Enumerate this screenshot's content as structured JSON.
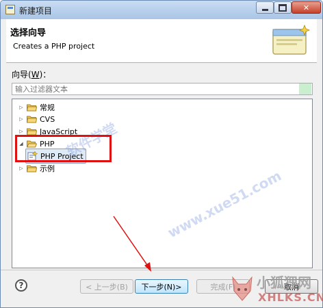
{
  "window": {
    "title": "新建项目"
  },
  "header": {
    "title": "选择向导",
    "description": "Creates a PHP project"
  },
  "wizards": {
    "label_prefix": "向导(",
    "label_mnemonic": "W",
    "label_suffix": ")：",
    "filter_placeholder": "输入过滤器文本"
  },
  "tree": {
    "items": [
      {
        "label": "常规",
        "state": "collapsed"
      },
      {
        "label": "CVS",
        "state": "collapsed"
      },
      {
        "label": "JavaScript",
        "state": "collapsed"
      },
      {
        "label": "PHP",
        "state": "expanded"
      },
      {
        "label": "PHP Project",
        "state": "selected"
      },
      {
        "label": "示例",
        "state": "collapsed"
      }
    ]
  },
  "buttons": {
    "back": "< 上一步(B)",
    "next": "下一步(N)>",
    "finish": "完成(F)",
    "cancel": "取消",
    "help": "?"
  },
  "watermark": {
    "line1": "软件学堂",
    "line2": "www.xue51.com"
  },
  "logo": {
    "line1": "小狐狸网",
    "line2": "XHLKS.CN"
  },
  "colors": {
    "title_gradient_top": "#c9dcf2",
    "header_bg": "#ffffff",
    "dialog_bg": "#f0f0f0",
    "highlight": "#e01010",
    "selected_bg": "#dfeaf7",
    "primary_button": "#bee6fd"
  }
}
